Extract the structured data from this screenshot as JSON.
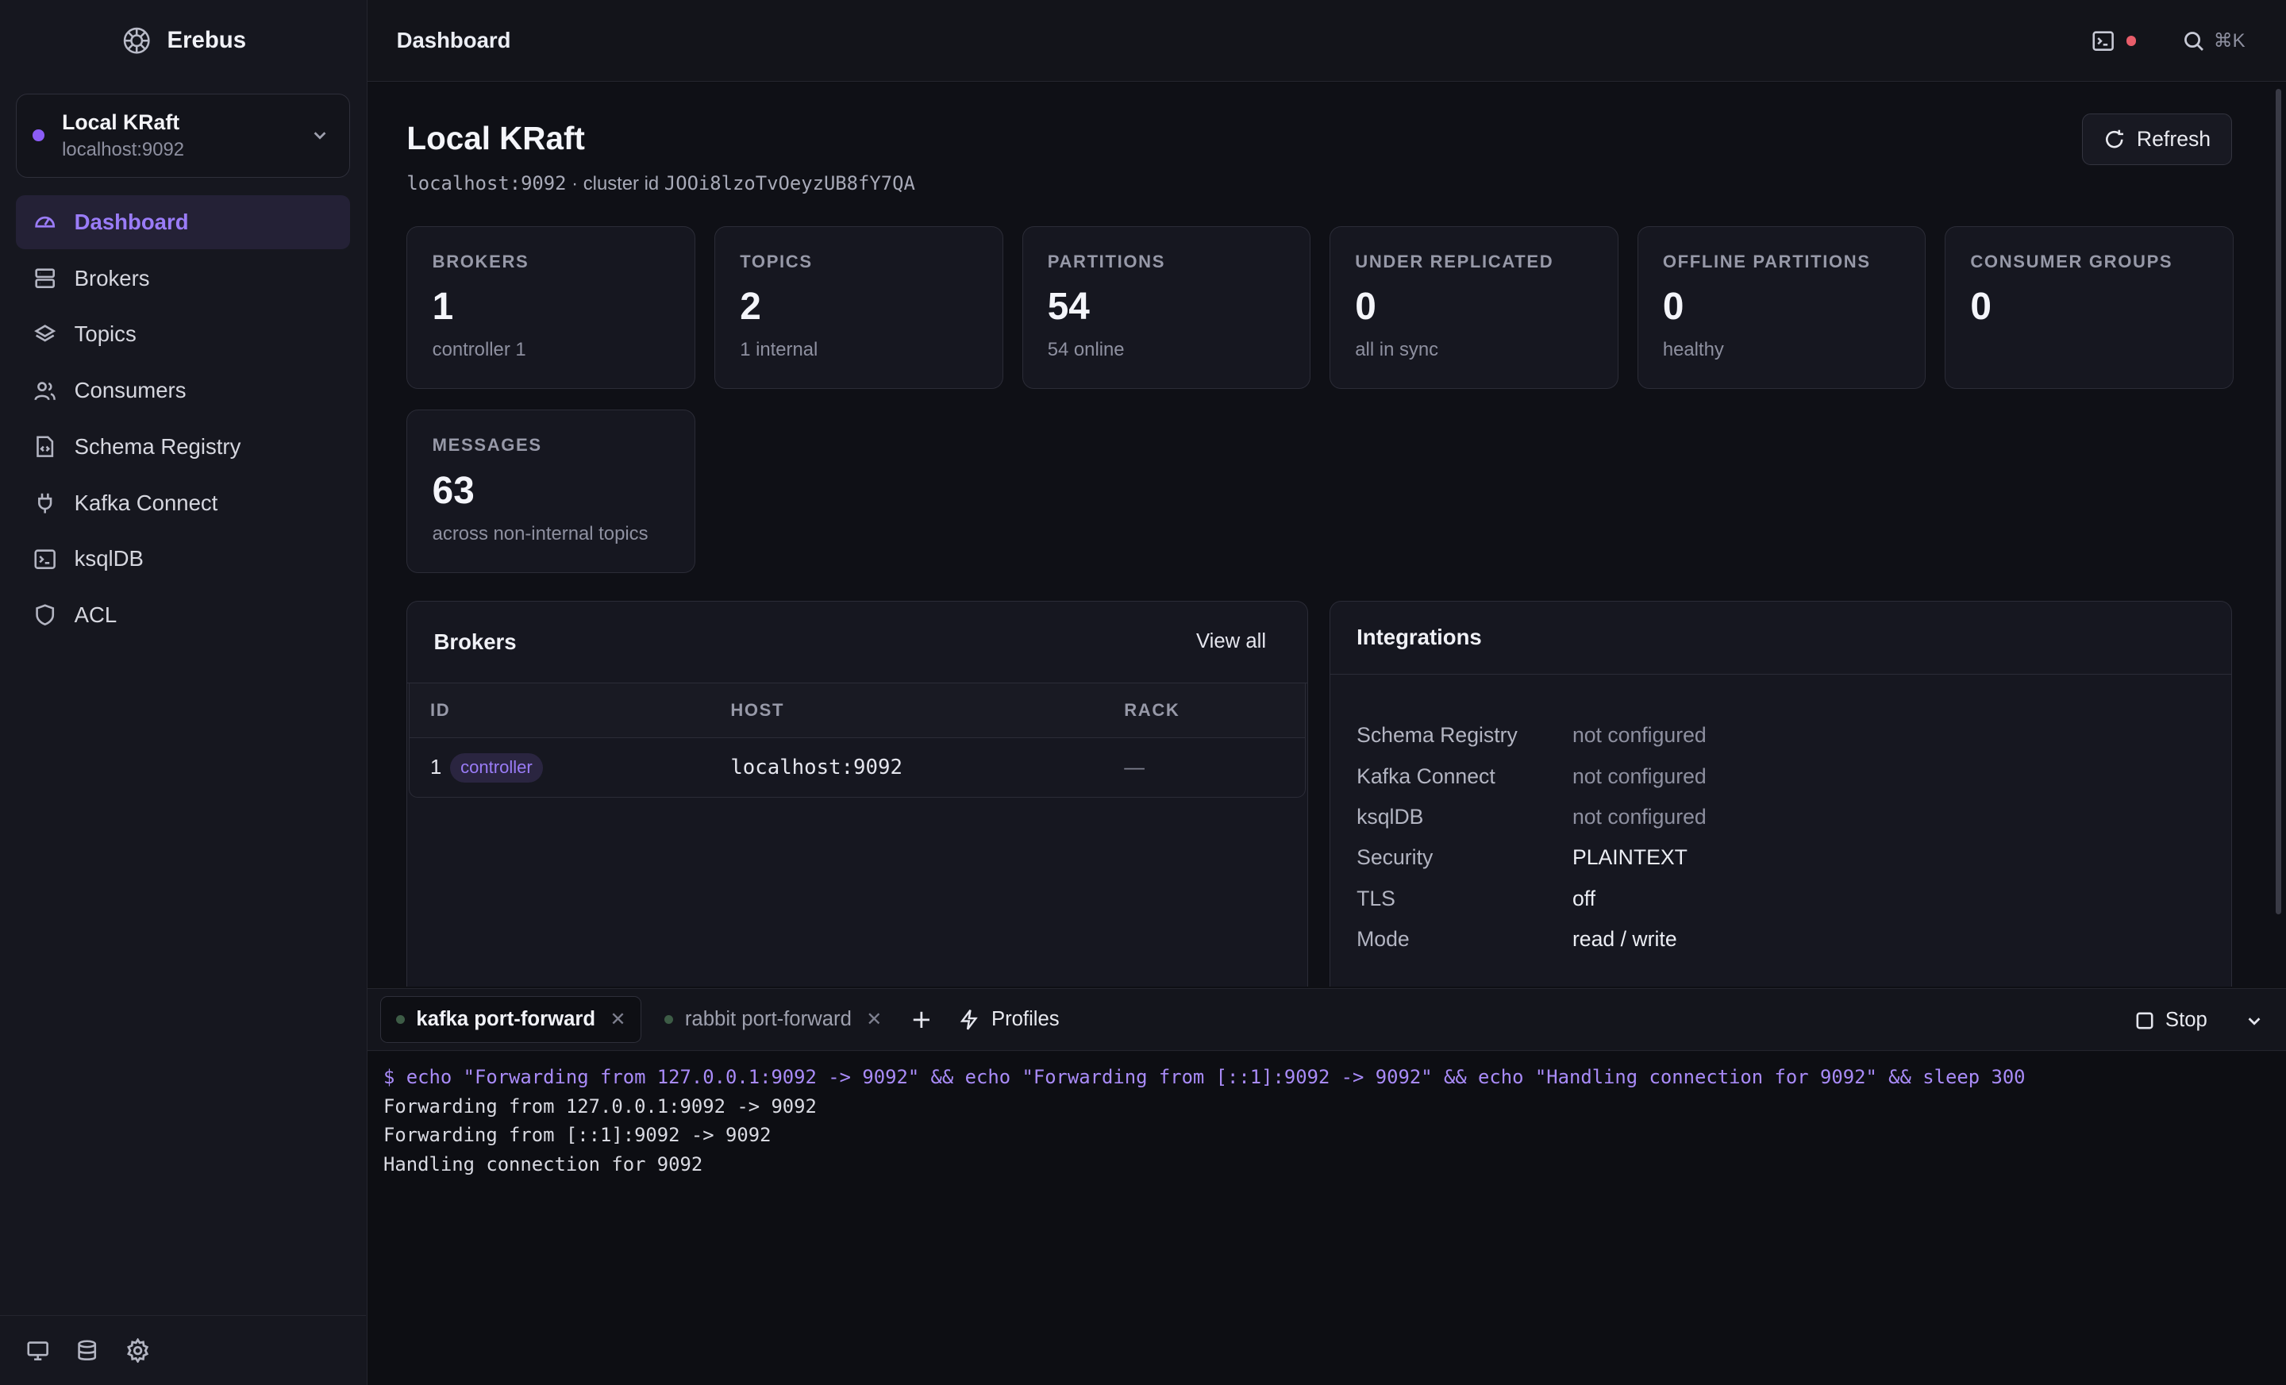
{
  "app": {
    "name": "Erebus"
  },
  "cluster_selector": {
    "name": "Local KRaft",
    "host": "localhost:9092"
  },
  "sidebar": {
    "items": [
      {
        "label": "Dashboard",
        "icon": "dashboard-gauge-icon",
        "active": true
      },
      {
        "label": "Brokers",
        "icon": "server-icon"
      },
      {
        "label": "Topics",
        "icon": "layers-icon"
      },
      {
        "label": "Consumers",
        "icon": "users-icon"
      },
      {
        "label": "Schema Registry",
        "icon": "file-code-icon"
      },
      {
        "label": "Kafka Connect",
        "icon": "plug-icon"
      },
      {
        "label": "ksqlDB",
        "icon": "terminal-square-icon"
      },
      {
        "label": "ACL",
        "icon": "shield-icon"
      }
    ],
    "footer_icons": [
      "monitor-icon",
      "database-icon",
      "settings-icon"
    ]
  },
  "topbar": {
    "title": "Dashboard",
    "shortcut": "⌘K"
  },
  "page": {
    "title": "Local KRaft",
    "host": "localhost:9092",
    "cluster_id_label": " · cluster id ",
    "cluster_id": "JOOi8lzoTvOeyzUB8fY7QA",
    "refresh_label": "Refresh"
  },
  "stats": [
    {
      "label": "BROKERS",
      "value": "1",
      "sub": "controller 1"
    },
    {
      "label": "TOPICS",
      "value": "2",
      "sub": "1 internal"
    },
    {
      "label": "PARTITIONS",
      "value": "54",
      "sub": "54 online"
    },
    {
      "label": "UNDER REPLICATED",
      "value": "0",
      "sub": "all in sync"
    },
    {
      "label": "OFFLINE PARTITIONS",
      "value": "0",
      "sub": "healthy"
    },
    {
      "label": "CONSUMER GROUPS",
      "value": "0",
      "sub": ""
    },
    {
      "label": "MESSAGES",
      "value": "63",
      "sub": "across non-internal topics"
    }
  ],
  "brokers_panel": {
    "title": "Brokers",
    "view_all": "View all",
    "columns": [
      "ID",
      "HOST",
      "RACK"
    ],
    "rows": [
      {
        "id": "1",
        "badge": "controller",
        "host": "localhost:9092",
        "rack": "—"
      }
    ]
  },
  "integrations": {
    "title": "Integrations",
    "rows": [
      {
        "key": "Schema Registry",
        "value": "not configured",
        "muted": true
      },
      {
        "key": "Kafka Connect",
        "value": "not configured",
        "muted": true
      },
      {
        "key": "ksqlDB",
        "value": "not configured",
        "muted": true
      },
      {
        "key": "Security",
        "value": "PLAINTEXT"
      },
      {
        "key": "TLS",
        "value": "off"
      },
      {
        "key": "Mode",
        "value": "read / write"
      }
    ]
  },
  "terminal": {
    "tabs": [
      {
        "label": "kafka port-forward",
        "active": true
      },
      {
        "label": "rabbit port-forward",
        "active": false
      }
    ],
    "profiles_label": "Profiles",
    "stop_label": "Stop",
    "command": "$ echo \"Forwarding from 127.0.0.1:9092 -> 9092\" && echo \"Forwarding from [::1]:9092 -> 9092\" && echo \"Handling connection for 9092\" && sleep 300",
    "output": [
      "Forwarding from 127.0.0.1:9092 -> 9092",
      "Forwarding from [::1]:9092 -> 9092",
      "Handling connection for 9092"
    ]
  }
}
